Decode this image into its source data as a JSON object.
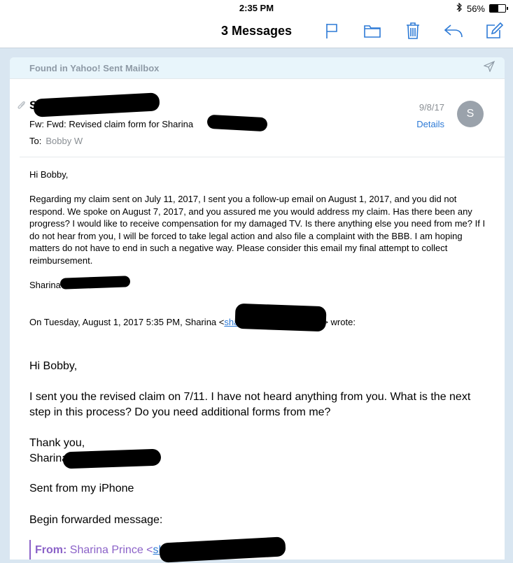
{
  "status": {
    "time": "2:35 PM",
    "battery": "56%",
    "battery_level": 0.56
  },
  "nav": {
    "title": "3 Messages",
    "tools": [
      "flag-icon",
      "folder-icon",
      "trash-icon",
      "reply-icon",
      "compose-icon"
    ]
  },
  "banner": {
    "text": "Found in Yahoo! Sent Mailbox",
    "icon": "sent-arrow-icon"
  },
  "message": {
    "sender": "Shar",
    "subject": "Fw: Fwd: Revised claim form for Sharina",
    "to_label": "To:",
    "to_name": "Bobby W",
    "date": "9/8/17",
    "details_label": "Details",
    "avatar_initial": "S"
  },
  "body": {
    "greeting": "Hi Bobby,",
    "paragraph": "Regarding my claim sent on July 11, 2017, I sent you a follow-up email on August 1, 2017, and you did not respond.  We spoke on August 7, 2017, and you assured me you would address my claim. Has there been any progress? I would like to receive compensation for my damaged TV. Is there anything else you need from me? If I do not hear from you, I will be forced to take legal action and also file a complaint with the BBB. I am hoping matters do not have to end in such a negative way. Please consider this email my final attempt to collect reimbursement.",
    "signature": "Sharina",
    "quote_intro": "On Tuesday, August 1, 2017 5:35 PM, Sharina <",
    "quote_link": "sha",
    "quote_wrote": "> wrote:",
    "q_greeting": "Hi Bobby,",
    "q_paragraph": "I sent you the revised claim on 7/11. I have not heard anything from you. What is the next step in this process? Do you need additional forms from me?",
    "q_thanks": "Thank you,",
    "q_signature": "Sharina",
    "q_sent_from": "Sent from my iPhone",
    "q_forwarded": "Begin forwarded message:",
    "from_label": "From:",
    "from_name": "Sharina Prince <",
    "from_link": "sha"
  }
}
